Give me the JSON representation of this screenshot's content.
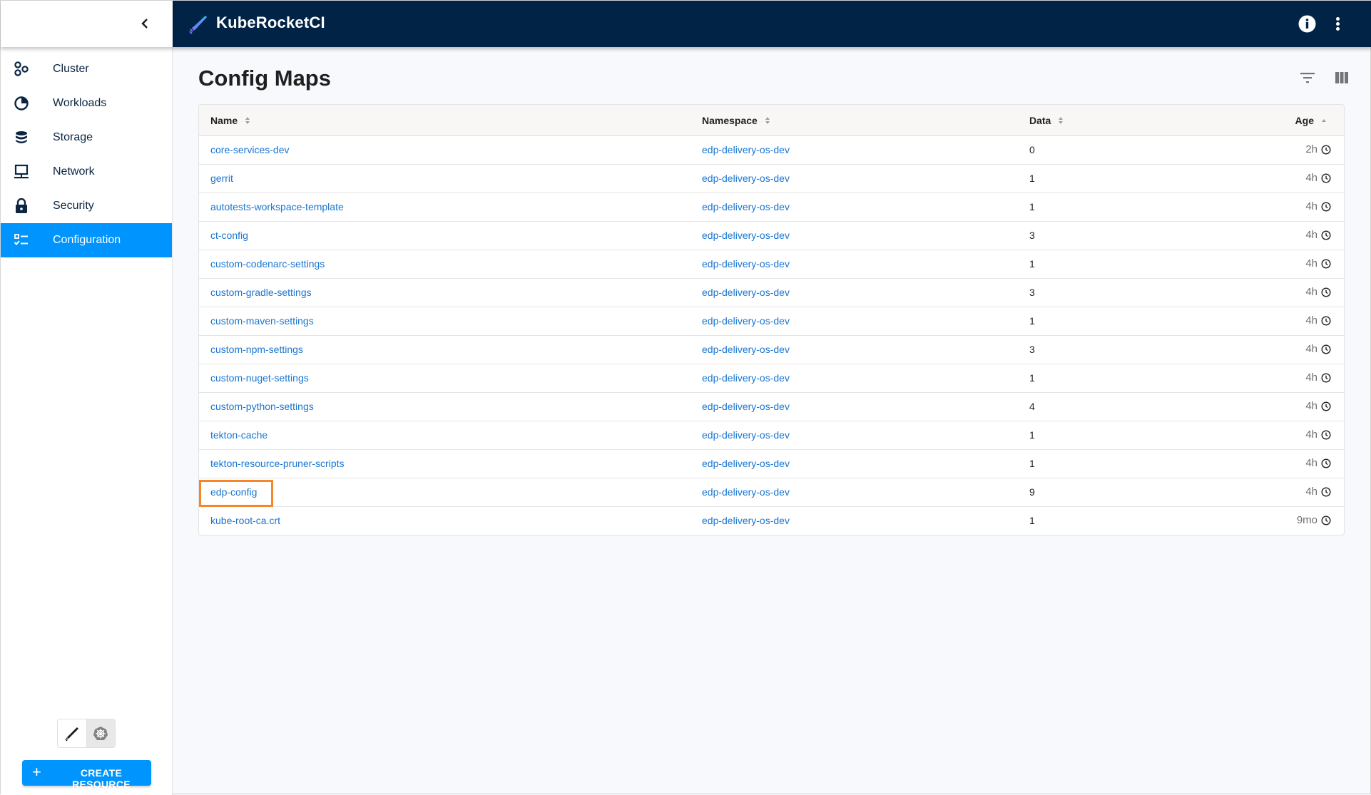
{
  "app": {
    "brand": "KubeRocketCI",
    "colors": {
      "header_bg": "#012346",
      "accent": "#0094ff",
      "link": "#1976d2",
      "highlight": "#f5862a"
    }
  },
  "sidebar": {
    "collapse_icon": "chevron-left-icon",
    "items": [
      {
        "label": "Cluster",
        "icon": "cluster-icon",
        "active": false
      },
      {
        "label": "Workloads",
        "icon": "workloads-icon",
        "active": false
      },
      {
        "label": "Storage",
        "icon": "storage-icon",
        "active": false
      },
      {
        "label": "Network",
        "icon": "network-icon",
        "active": false
      },
      {
        "label": "Security",
        "icon": "lock-icon",
        "active": false
      },
      {
        "label": "Configuration",
        "icon": "configuration-icon",
        "active": true
      }
    ],
    "mode_toggle": [
      {
        "icon": "krci-rocket-icon",
        "selected": false
      },
      {
        "icon": "kubernetes-icon",
        "selected": true
      }
    ],
    "create_button": {
      "icon": "plus-icon",
      "label": "CREATE RESOURCE"
    }
  },
  "topbar": {
    "info_icon": "info-icon",
    "menu_icon": "more-vert-icon"
  },
  "main": {
    "title": "Config Maps",
    "toolbar": {
      "filter_icon": "filter-icon",
      "columns_icon": "columns-icon"
    },
    "table": {
      "columns": [
        {
          "label": "Name",
          "sort": "none"
        },
        {
          "label": "Namespace",
          "sort": "none"
        },
        {
          "label": "Data",
          "sort": "none"
        },
        {
          "label": "Age",
          "sort": "asc"
        }
      ],
      "rows": [
        {
          "name": "core-services-dev",
          "namespace": "edp-delivery-os-dev",
          "data": "0",
          "age": "2h"
        },
        {
          "name": "gerrit",
          "namespace": "edp-delivery-os-dev",
          "data": "1",
          "age": "4h"
        },
        {
          "name": "autotests-workspace-template",
          "namespace": "edp-delivery-os-dev",
          "data": "1",
          "age": "4h"
        },
        {
          "name": "ct-config",
          "namespace": "edp-delivery-os-dev",
          "data": "3",
          "age": "4h"
        },
        {
          "name": "custom-codenarc-settings",
          "namespace": "edp-delivery-os-dev",
          "data": "1",
          "age": "4h"
        },
        {
          "name": "custom-gradle-settings",
          "namespace": "edp-delivery-os-dev",
          "data": "3",
          "age": "4h"
        },
        {
          "name": "custom-maven-settings",
          "namespace": "edp-delivery-os-dev",
          "data": "1",
          "age": "4h"
        },
        {
          "name": "custom-npm-settings",
          "namespace": "edp-delivery-os-dev",
          "data": "3",
          "age": "4h"
        },
        {
          "name": "custom-nuget-settings",
          "namespace": "edp-delivery-os-dev",
          "data": "1",
          "age": "4h"
        },
        {
          "name": "custom-python-settings",
          "namespace": "edp-delivery-os-dev",
          "data": "4",
          "age": "4h"
        },
        {
          "name": "tekton-cache",
          "namespace": "edp-delivery-os-dev",
          "data": "1",
          "age": "4h"
        },
        {
          "name": "tekton-resource-pruner-scripts",
          "namespace": "edp-delivery-os-dev",
          "data": "1",
          "age": "4h"
        },
        {
          "name": "edp-config",
          "namespace": "edp-delivery-os-dev",
          "data": "9",
          "age": "4h",
          "highlighted": true
        },
        {
          "name": "kube-root-ca.crt",
          "namespace": "edp-delivery-os-dev",
          "data": "1",
          "age": "9mo"
        }
      ]
    }
  }
}
